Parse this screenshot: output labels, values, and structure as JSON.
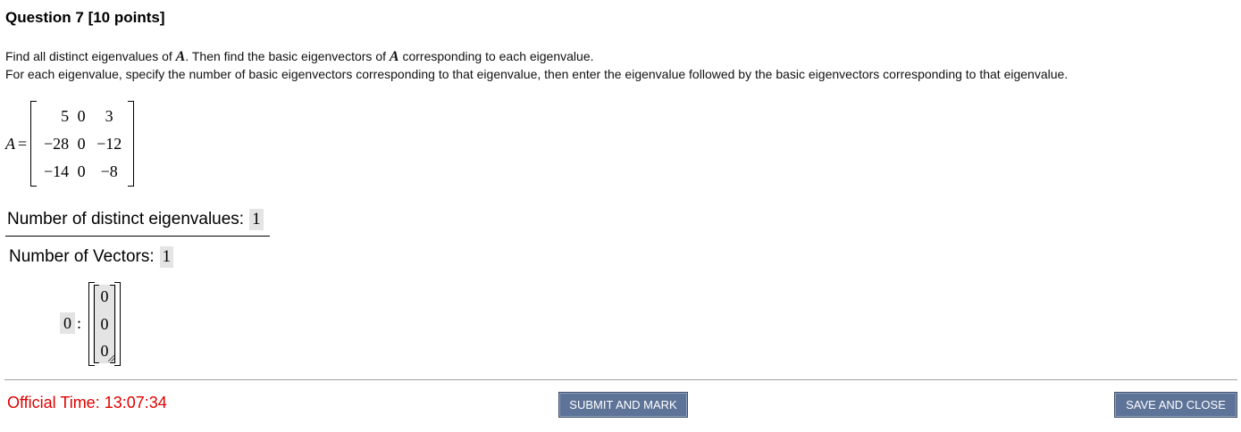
{
  "question": {
    "title": "Question 7 [10 points]",
    "instruction_line1_prefix": "Find all distinct eigenvalues of ",
    "instruction_line1_var": "A",
    "instruction_line1_middle": ". Then find the basic eigenvectors of ",
    "instruction_line1_var2": "A",
    "instruction_line1_suffix": " corresponding to each eigenvalue.",
    "instruction_line2": "For each eigenvalue, specify the number of basic eigenvectors corresponding to that eigenvalue, then enter the eigenvalue followed by the basic eigenvectors corresponding to that eigenvalue."
  },
  "matrix": {
    "label": "A",
    "equals": "=",
    "rows": [
      [
        "5",
        "0",
        "3"
      ],
      [
        "−28",
        "0",
        "−12"
      ],
      [
        "−14",
        "0",
        "−8"
      ]
    ]
  },
  "answers": {
    "distinct_label": "Number of distinct eigenvalues:",
    "distinct_value": "1",
    "vectors_label": "Number of Vectors:",
    "vectors_value": "1",
    "eigenvalue": "0",
    "colon": ":",
    "eigenvector": [
      "0",
      "0",
      "0"
    ]
  },
  "footer": {
    "official_time": "Official Time: 13:07:34",
    "submit_label": "SUBMIT AND MARK",
    "save_label": "SAVE AND CLOSE"
  },
  "colors": {
    "button_bg": "#5d7398",
    "time_red": "#e00000",
    "input_bg": "#e4e4e4"
  }
}
